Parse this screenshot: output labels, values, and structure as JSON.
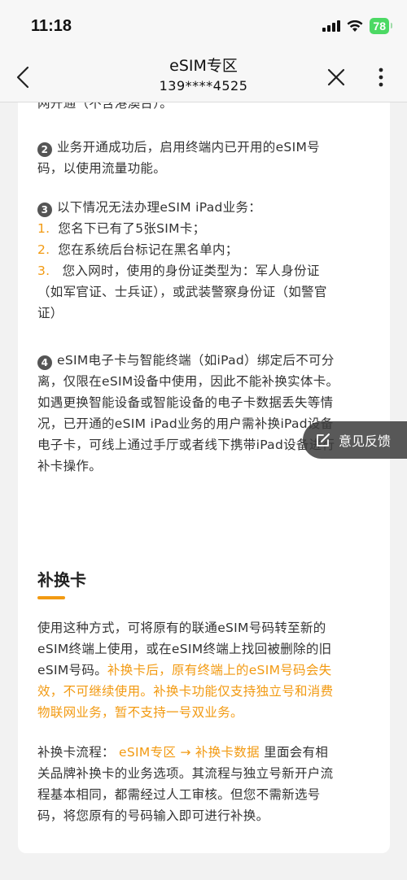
{
  "status_bar": {
    "time": "11:18",
    "battery": "78"
  },
  "nav": {
    "title": "eSIM专区",
    "subtitle": "139****4525"
  },
  "card1": {
    "cut_text": "网开通（不含港澳台）。",
    "item2": {
      "num": "2",
      "text_line1": "业务开通成功后，启用终端内已开用的eSIM号",
      "text_line2": "码，以使用流量功能。"
    },
    "item3": {
      "num": "3",
      "text": "以下情况无法办理eSIM iPad业务：",
      "sub": [
        {
          "num": "1.",
          "text": "您名下已有了5张SIM卡；"
        },
        {
          "num": "2.",
          "text": "您在系统后台标记在黑名单内；"
        },
        {
          "num": "3.",
          "text": " 您入网时，使用的身份证类型为：军人身份证"
        }
      ],
      "cont_line1": "（如军官证、士兵证），或武装警察身份证（如警官",
      "cont_line2": "证）"
    },
    "item4": {
      "num": "4",
      "lines": [
        "eSIM电子卡与智能终端（如iPad）绑定后不可分",
        "离，仅限在eSIM设备中使用，因此不能补换实体卡。",
        "如遇更换智能设备或智能设备的电子卡数据丢失等情",
        "况，已开通的eSIM iPad业务的用户需补换iPad设备",
        "电子卡，可线上通过手厅或者线下携带iPad设备进行",
        "补卡操作。"
      ]
    }
  },
  "feedback": {
    "label": "意见反馈"
  },
  "card2": {
    "title": "补换卡",
    "para1_line1": "使用这种方式，可将原有的联通eSIM号码转至新的",
    "para1_line2": "eSIM终端上使用，或在eSIM终端上找回被删除的旧",
    "para1_line3_normal": "eSIM号码。",
    "para1_line3_orange": "补换卡后，原有终端上的eSIM号码会失",
    "para1_line4_orange": "效，不可继续使用。补换卡功能仅支持独立号和消费",
    "para1_line5_orange": "物联网业务，暂不支持一号双业务。",
    "para2_label": "补换卡流程：",
    "para2_path": "eSIM专区 → 补换卡数据",
    "para2_line1_rest": "里面会有相",
    "para2_line2": "关品牌补换卡的业务选项。其流程与独立号新开户流",
    "para2_line3": "程基本相同，都需经过人工审核。但您不需新选号",
    "para2_line4": "码，将您原有的号码输入即可进行补换。"
  },
  "colors": {
    "accent": "#f29a12",
    "battery": "#4cd964"
  }
}
